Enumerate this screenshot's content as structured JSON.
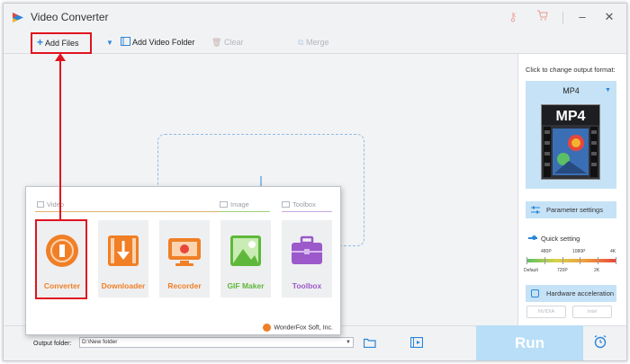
{
  "window": {
    "title": "Video Converter"
  },
  "toolbar": {
    "add_files": "Add Files",
    "add_video_folder": "Add Video Folder",
    "clear": "Clear",
    "merge": "Merge"
  },
  "right_panel": {
    "change_label": "Click to change output format:",
    "format_name": "MP4",
    "format_art_text": "MP4",
    "parameter_settings": "Parameter settings",
    "quick_setting": "Quick setting",
    "quality_top": [
      "480P",
      "1080P",
      "4K"
    ],
    "quality_bottom": [
      "Default",
      "720P",
      "2K"
    ],
    "hardware_acceleration": "Hardware acceleration",
    "nvidia": "NVIDIA",
    "intel": "Intel"
  },
  "bottom": {
    "output_label": "Output folder:",
    "output_path": "D:\\New folder",
    "run": "Run"
  },
  "popup": {
    "categories": {
      "video": "Video",
      "image": "Image",
      "toolbox": "Toolbox"
    },
    "tiles": [
      {
        "label": "Converter",
        "color": "#f07f26"
      },
      {
        "label": "Downloader",
        "color": "#f07f26"
      },
      {
        "label": "Recorder",
        "color": "#f07f26"
      },
      {
        "label": "GIF Maker",
        "color": "#5fb83b"
      },
      {
        "label": "Toolbox",
        "color": "#9b59c9"
      }
    ],
    "credit": "WonderFox Soft, Inc."
  },
  "colors": {
    "accent": "#2a86d8",
    "highlight": "#e0131f",
    "panel_blue": "#c6e2f6",
    "run_disabled": "#b8def8"
  }
}
